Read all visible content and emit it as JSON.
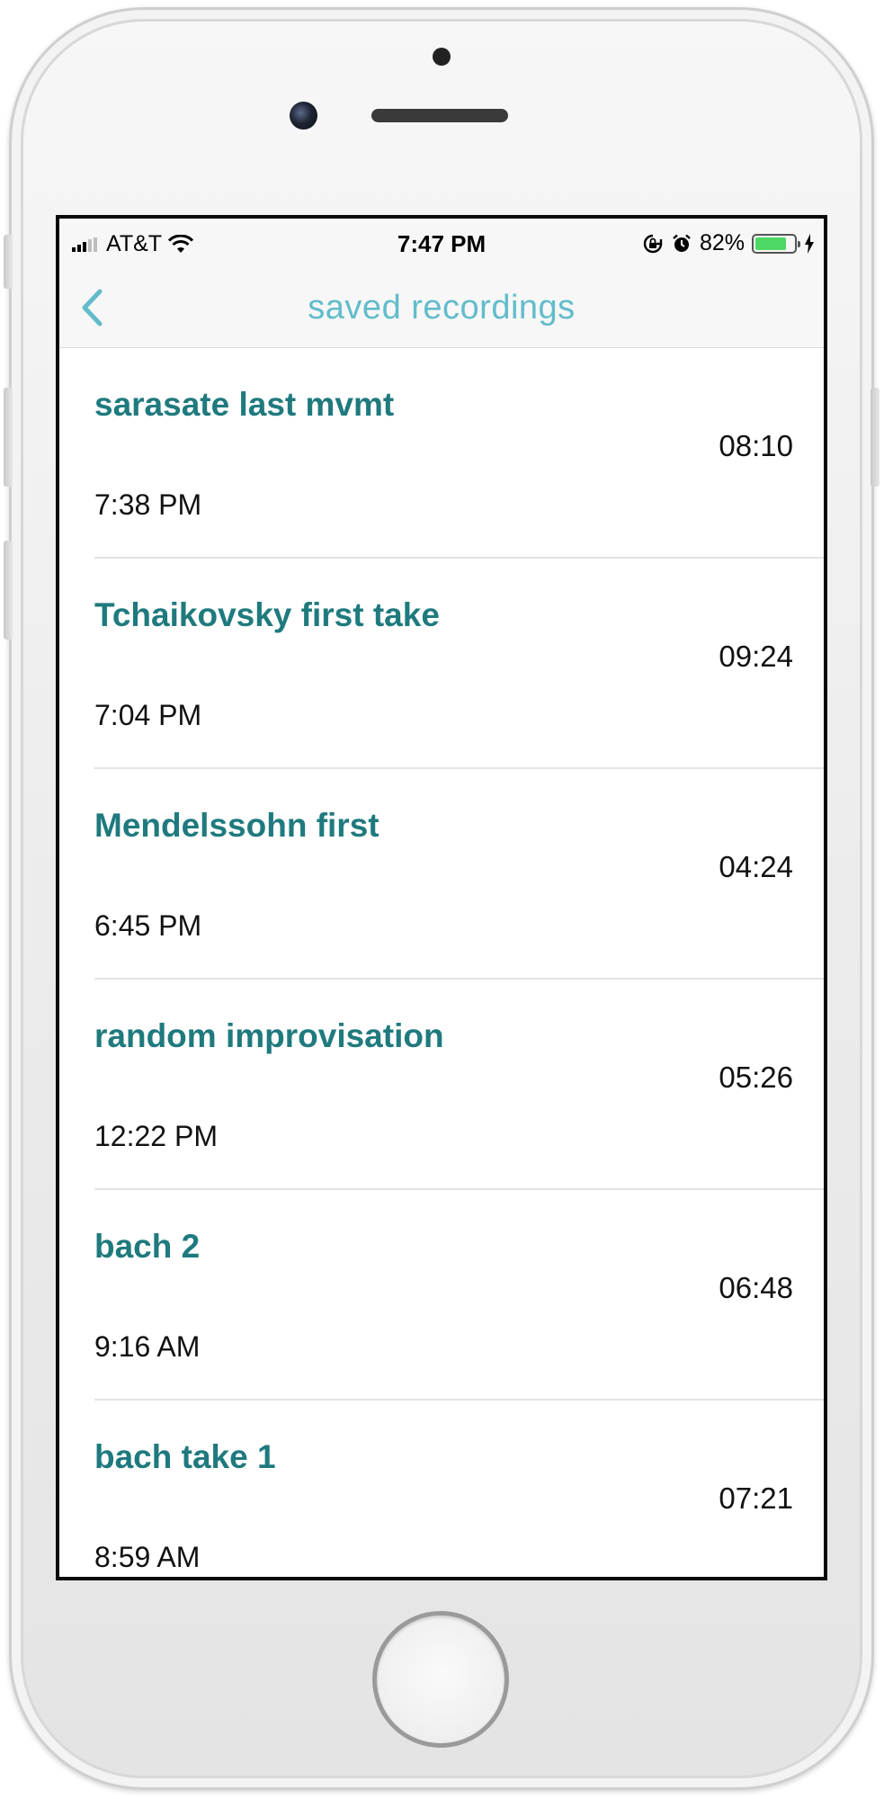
{
  "status_bar": {
    "carrier": "AT&T",
    "time": "7:47 PM",
    "battery_percent": "82%",
    "battery_level": 0.82,
    "icons": [
      "cellular-signal-icon",
      "wifi-icon",
      "rotation-lock-icon",
      "alarm-icon",
      "battery-icon",
      "charging-bolt-icon"
    ]
  },
  "nav": {
    "title": "saved recordings",
    "back_icon": "chevron-left-icon"
  },
  "colors": {
    "accent": "#62bccb",
    "title_teal": "#1f7a7e",
    "battery_green": "#4cd964"
  },
  "recordings": [
    {
      "title": "sarasate last mvmt",
      "time": "7:38 PM",
      "duration": "08:10"
    },
    {
      "title": "Tchaikovsky first take",
      "time": "7:04 PM",
      "duration": "09:24"
    },
    {
      "title": "Mendelssohn first",
      "time": "6:45 PM",
      "duration": "04:24"
    },
    {
      "title": "random improvisation",
      "time": "12:22 PM",
      "duration": "05:26"
    },
    {
      "title": "bach 2",
      "time": "9:16 AM",
      "duration": "06:48"
    },
    {
      "title": "bach take 1",
      "time": "8:59 AM",
      "duration": "07:21"
    }
  ]
}
